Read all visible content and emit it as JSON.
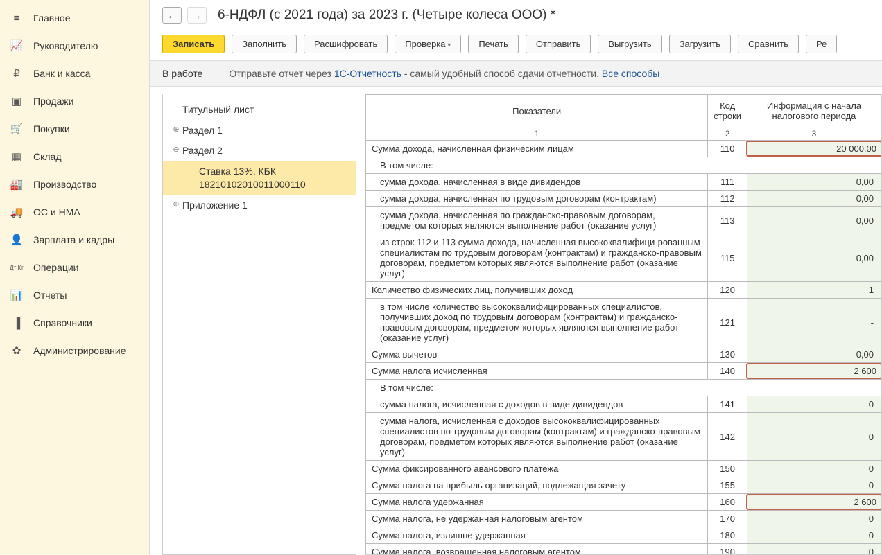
{
  "sidebar": {
    "items": [
      {
        "icon": "menu",
        "label": "Главное"
      },
      {
        "icon": "chart",
        "label": "Руководителю"
      },
      {
        "icon": "ruble",
        "label": "Банк и касса"
      },
      {
        "icon": "box",
        "label": "Продажи"
      },
      {
        "icon": "cart",
        "label": "Покупки"
      },
      {
        "icon": "warehouse",
        "label": "Склад"
      },
      {
        "icon": "factory",
        "label": "Производство"
      },
      {
        "icon": "truck",
        "label": "ОС и НМА"
      },
      {
        "icon": "person",
        "label": "Зарплата и кадры"
      },
      {
        "icon": "ops",
        "label": "Операции"
      },
      {
        "icon": "bars",
        "label": "Отчеты"
      },
      {
        "icon": "book",
        "label": "Справочники"
      },
      {
        "icon": "gear",
        "label": "Администрирование"
      }
    ]
  },
  "header": {
    "title": "6-НДФЛ (с 2021 года) за 2023 г. (Четыре колеса ООО) *"
  },
  "toolbar": {
    "save": "Записать",
    "fill": "Заполнить",
    "decode": "Расшифровать",
    "check": "Проверка",
    "print": "Печать",
    "send": "Отправить",
    "export": "Выгрузить",
    "import": "Загрузить",
    "compare": "Сравнить",
    "more": "Ре"
  },
  "info": {
    "status": "В работе",
    "text_pre": "Отправьте отчет через ",
    "link1": "1С-Отчетность",
    "text_mid": " - самый удобный способ сдачи отчетности. ",
    "link2": "Все способы"
  },
  "tree": {
    "items": [
      {
        "label": "Титульный лист",
        "toggle": "",
        "level": 1
      },
      {
        "label": "Раздел 1",
        "toggle": "⊕",
        "level": 1
      },
      {
        "label": "Раздел 2",
        "toggle": "⊖",
        "level": 1
      },
      {
        "label": "Ставка 13%, КБК 18210102010011000110",
        "toggle": "",
        "level": 2,
        "selected": true
      },
      {
        "label": "Приложение 1",
        "toggle": "⊕",
        "level": 1
      }
    ]
  },
  "grid": {
    "headers": {
      "c1": "Показатели",
      "c2": "Код строки",
      "c3": "Информация с начала налогового периода"
    },
    "sub": {
      "c1": "1",
      "c2": "2",
      "c3": "3"
    },
    "rows": [
      {
        "indicator": "Сумма дохода, начисленная физическим лицам",
        "code": "110",
        "value": "20 000,00",
        "hl": true
      },
      {
        "indicator": "В том числе:",
        "group": true
      },
      {
        "indicator": "сумма дохода, начисленная в виде дивидендов",
        "code": "111",
        "value": "0,00",
        "indent": true
      },
      {
        "indicator": "сумма дохода, начисленная по трудовым договорам (контрактам)",
        "code": "112",
        "value": "0,00",
        "indent": true
      },
      {
        "indicator": "сумма дохода, начисленная по гражданско-правовым договорам, предметом которых являются выполнение работ (оказание услуг)",
        "code": "113",
        "value": "0,00",
        "indent": true
      },
      {
        "indicator": "из строк 112 и 113 сумма дохода, начисленная высококвалифици-рованным специалистам по трудовым договорам (контрактам) и гражданско-правовым договорам, предметом которых являются выполнение работ (оказание услуг)",
        "code": "115",
        "value": "0,00",
        "indent": true
      },
      {
        "indicator": "Количество физических лиц, получивших доход",
        "code": "120",
        "value": "1"
      },
      {
        "indicator": "в том числе количество высококвалифицированных специалистов, получивших доход по трудовым договорам (контрактам) и гражданско-правовым договорам, предметом которых являются выполнение работ (оказание услуг)",
        "code": "121",
        "value": "-",
        "indent": true
      },
      {
        "indicator": "Сумма вычетов",
        "code": "130",
        "value": "0,00"
      },
      {
        "indicator": "Сумма налога исчисленная",
        "code": "140",
        "value": "2 600",
        "hl": true
      },
      {
        "indicator": "В том числе:",
        "group": true
      },
      {
        "indicator": "сумма налога, исчисленная с доходов в виде дивидендов",
        "code": "141",
        "value": "0",
        "indent": true
      },
      {
        "indicator": "сумма налога, исчисленная с доходов высококвалифицированных специалистов по трудовым договорам (контрактам) и гражданско-правовым договорам, предметом которых являются выполнение работ (оказание услуг)",
        "code": "142",
        "value": "0",
        "indent": true
      },
      {
        "indicator": "Сумма фиксированного авансового платежа",
        "code": "150",
        "value": "0"
      },
      {
        "indicator": "Сумма налога на прибыль организаций, подлежащая зачету",
        "code": "155",
        "value": "0"
      },
      {
        "indicator": "Сумма налога удержанная",
        "code": "160",
        "value": "2 600",
        "hl": true
      },
      {
        "indicator": "Сумма налога, не удержанная налоговым агентом",
        "code": "170",
        "value": "0"
      },
      {
        "indicator": "Сумма налога, излишне удержанная",
        "code": "180",
        "value": "0"
      },
      {
        "indicator": "Сумма налога, возвращенная налоговым агентом",
        "code": "190",
        "value": "0"
      }
    ]
  }
}
